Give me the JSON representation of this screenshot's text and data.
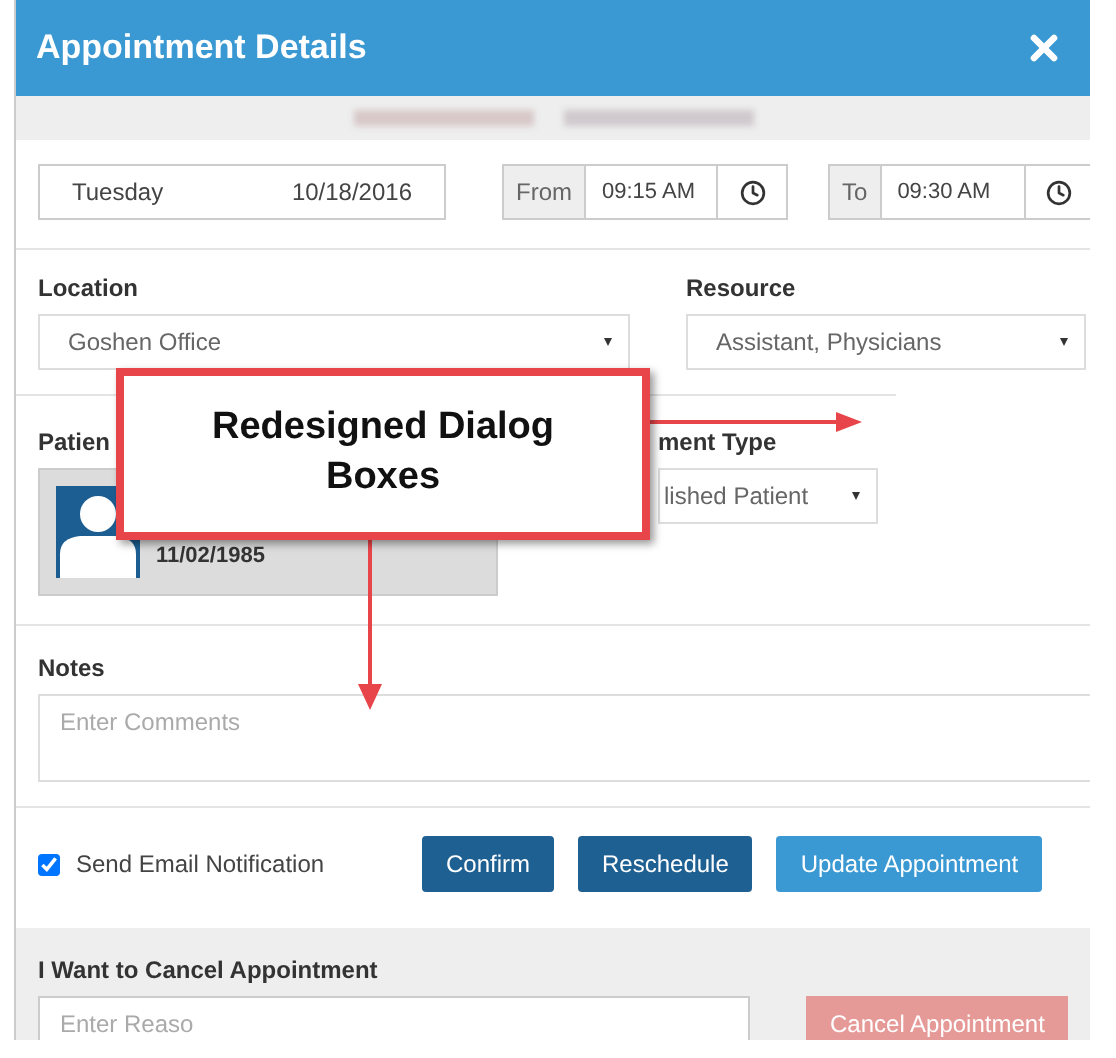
{
  "dialog": {
    "title": "Appointment Details"
  },
  "date": {
    "day": "Tuesday",
    "date": "10/18/2016"
  },
  "from": {
    "label": "From",
    "value": "09:15 AM"
  },
  "to": {
    "label": "To",
    "value": "09:30 AM"
  },
  "location": {
    "label": "Location",
    "value": "Goshen Office"
  },
  "resource": {
    "label": "Resource",
    "value": "Assistant, Physicians"
  },
  "patient": {
    "label": "Patien",
    "dob": "11/02/1985"
  },
  "appointment_type": {
    "label": "ment Type",
    "value": "lished Patient"
  },
  "notes": {
    "label": "Notes",
    "placeholder": "Enter Comments"
  },
  "email_notification": {
    "label": "Send Email Notification",
    "checked": true
  },
  "buttons": [
    {
      "label": "Confirm",
      "kind": "dark"
    },
    {
      "label": "Reschedule",
      "kind": "dark"
    },
    {
      "label": "Update Appointment",
      "kind": "light"
    }
  ],
  "cancel": {
    "label": "I Want to Cancel Appointment",
    "placeholder": "Enter Reaso",
    "button": "Cancel Appointment"
  },
  "annotation": {
    "text": "Redesigned Dialog Boxes"
  }
}
